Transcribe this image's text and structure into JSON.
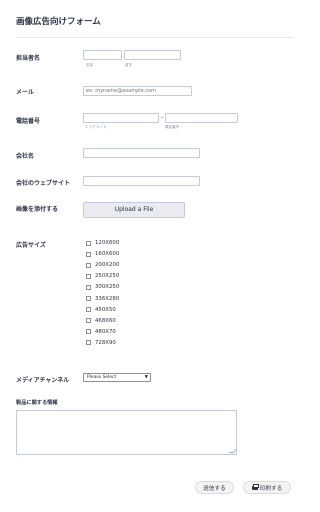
{
  "form": {
    "title": "画像広告向けフォーム"
  },
  "contact": {
    "label": "担当者名",
    "first_name_sublabel": "名前",
    "last_name_sublabel": "苗字"
  },
  "email": {
    "label": "メール",
    "placeholder": "ex: myname@example.com"
  },
  "phone": {
    "label": "電話番号",
    "separator": "-",
    "area_code_sublabel": "エリアコード",
    "number_sublabel": "電話番号"
  },
  "company": {
    "label": "会社名"
  },
  "website": {
    "label": "会社のウェブサイト"
  },
  "image_upload": {
    "label": "画像を添付する",
    "button_label": "Upload a File"
  },
  "ad_size": {
    "label": "広告サイズ",
    "options": [
      {
        "label": "120X600",
        "checked": false
      },
      {
        "label": "160X600",
        "checked": false
      },
      {
        "label": "200X200",
        "checked": false
      },
      {
        "label": "250X250",
        "checked": false
      },
      {
        "label": "300X250",
        "checked": false
      },
      {
        "label": "336X280",
        "checked": false
      },
      {
        "label": "450X50",
        "checked": false
      },
      {
        "label": "468X60",
        "checked": false
      },
      {
        "label": "480X70",
        "checked": false
      },
      {
        "label": "728X90",
        "checked": false
      }
    ]
  },
  "media_channel": {
    "label": "メディアチャンネル",
    "selected": "Please Select"
  },
  "product_info": {
    "label": "製品に関する情報"
  },
  "actions": {
    "submit_label": "送信する",
    "print_label": "印刷する"
  },
  "colors": {
    "text": "#2c3345",
    "border": "#c3cad8",
    "button_bg": "#f3f3f3",
    "upload_bg": "#e9ebf1"
  },
  "icons": {
    "print": "printer-icon",
    "select_chevron": "chevron-down-icon"
  }
}
